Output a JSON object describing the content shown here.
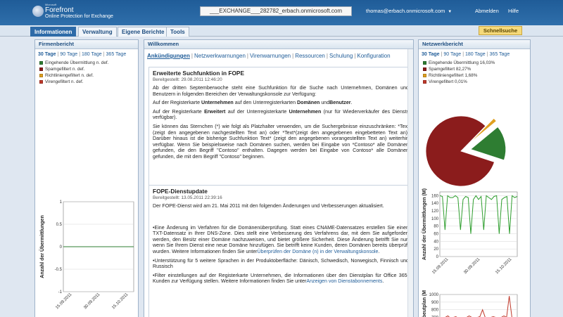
{
  "header": {
    "logo_small": "Microsoft",
    "logo_product": "Forefront",
    "logo_sub": "Online Protection for Exchange",
    "tenant": "___EXCHANGE___282782_erbach.onmicrosoft.com",
    "user": "thomas@erbach.onmicrosoft.com",
    "links": [
      "Abmelden",
      "Hilfe"
    ]
  },
  "tabs": [
    "Informationen",
    "Verwaltung",
    "Eigene Berichte",
    "Tools"
  ],
  "quick_search": "Schnellsuche",
  "left_panel": {
    "title": "Firmenbericht",
    "ranges": [
      "30 Tage",
      "90 Tage",
      "180 Tage",
      "365 Tage"
    ],
    "legend": [
      {
        "label": "Eingehende Übermittlung n. def.",
        "color": "#2e7d32"
      },
      {
        "label": "Spamgefiltert n. def.",
        "color": "#8b1c1c"
      },
      {
        "label": "Richtliniengefiltert n. def.",
        "color": "#e0a020"
      },
      {
        "label": "Virengefiltert n. def.",
        "color": "#c0392b"
      }
    ]
  },
  "center_panel": {
    "title": "Willkommen",
    "subnav": [
      "Ankündigungen",
      "Netzwerkwarnungen",
      "Virenwarnungen",
      "Ressourcen",
      "Schulung",
      "Konfiguration"
    ],
    "news": [
      {
        "title": "Erweiterte Suchfunktion in FOPE",
        "date": "Bereitgestellt: 29.08.2011 12:46:20",
        "p1": "Ab der dritten Septemberwoche steht eine Suchfunktion für die Suche nach Unternehmen, Domänen und Benutzern in folgenden Bereichen der Verwaltungskonsole zur Verfügung:",
        "p2a": "Auf der Registerkarte ",
        "p2b": "Unternehmen",
        "p2c": " auf den Unterregisterkarten ",
        "p2d": "Domänen",
        "p2e": " und",
        "p2f": "Benutzer",
        "p2g": ".",
        "p3a": "Auf der Registerkarte ",
        "p3b": "Erweitert",
        "p3c": " auf der Unterregisterkarte ",
        "p3d": "Unternehmen",
        "p3e": " (nur für Wiederverkäufer des Diensts verfügbar).",
        "p4": "Sie können das Sternchen (*) wie folgt als Platzhalter verwenden, um die Suchergebnisse einzuschränken: *Text (zeigt den angegebenen nachgestellten Text an) oder *Text*(zeigt den angegebenen eingebetteten Text an). Darüber hinaus ist die bisherige Suchfunktion Text* (zeigt den angegebenen vorangestellten Text an) weiterhin verfügbar. Wenn Sie beispielsweise nach Domänen suchen, werden bei Eingabe von *Contoso* alle Domänen gefunden, die den Begriff \"Contoso\" enthalten. Dagegen werden bei Eingabe von Contoso* alle Domänen gefunden, die mit dem Begriff \"Contoso\" beginnen."
      },
      {
        "title": "FOPE-Dienstupdate",
        "date": "Bereitgestellt: 13.05.2011 22:39:16",
        "p1": "Der FOPE-Dienst wird am 21. Mai 2011 mit den folgenden Änderungen und Verbesserungen aktualisiert.",
        "p2": "•Eine Änderung im Verfahren für die Domänenüberprüfung. Statt eines CNAME-Datensatzes erstellen Sie einen TXT-Datensatz in Ihrer DNS-Zone. Dies stellt eine Verbesserung des Verfahrens dar, mit dem Sie aufgefordert werden, den Besitz einer Domäne nachzuweisen, und bietet größere Sicherheit. Diese Änderung betrifft Sie nur, wenn Sie Ihrem Dienst eine neue Domäne hinzufügen. Sie betrifft keine Kunden, deren Domänen bereits überprüft wurden. Weitere Informationen finden Sie unter",
        "p2link": "Überprüfen der Domäne (n) in der Verwaltungskonsole",
        "p2end": ".",
        "p3": "•Unterstützung für 5 weitere Sprachen in der Produktoberfläche: Dänisch, Schwedisch, Norwegisch, Finnisch und Russisch",
        "p4": "•Filter einstellungen auf der Registerkarte Unternehmen, die Informationen über den Dienstplan für Office 365-Kunden zur Verfügung stellen. Weitere Informationen finden Sie unter",
        "p4link": "Anzeigen von Dienstabonnements",
        "p4end": "."
      }
    ]
  },
  "right_panel": {
    "title": "Netzwerkbericht",
    "ranges": [
      "30 Tage",
      "90 Tage",
      "180 Tage",
      "365 Tage"
    ],
    "legend": [
      {
        "label": "Eingehende Übermittlung 16,03%",
        "color": "#2e7d32"
      },
      {
        "label": "Spamgefiltert 82,27%",
        "color": "#8b1c1c"
      },
      {
        "label": "Richtliniengefiltert 1,68%",
        "color": "#e0a020"
      },
      {
        "label": "Virengefiltert 0,01%",
        "color": "#c0392b"
      }
    ]
  },
  "chart_data": [
    {
      "type": "line",
      "ylabel": "Anzahl der Übermittlungen",
      "x_ticks": [
        "15.09.2011",
        "30.09.2011",
        "15.10.2011"
      ],
      "y_ticks": [
        1,
        0.5,
        0,
        -0.5,
        -1
      ],
      "ylim": [
        -1,
        1
      ],
      "series": [
        {
          "color": "#2e7d32",
          "values": [
            0,
            0,
            0,
            0,
            0,
            0,
            0,
            0,
            0,
            0,
            0,
            0,
            0,
            0,
            0,
            0,
            0,
            0,
            0,
            0,
            0,
            0,
            0,
            0,
            0,
            0,
            0,
            0,
            0,
            0
          ]
        }
      ]
    },
    {
      "type": "pie",
      "slices": [
        {
          "label": "Eingehende Übermittlung",
          "value": 16.03,
          "color": "#2e7d32"
        },
        {
          "label": "Spamgefiltert",
          "value": 82.27,
          "color": "#8b1c1c"
        },
        {
          "label": "Richtliniengefiltert",
          "value": 1.68,
          "color": "#e0a020"
        },
        {
          "label": "Virengefiltert",
          "value": 0.01,
          "color": "#c0392b"
        }
      ]
    },
    {
      "type": "line",
      "ylabel": "Anzahl der Übermittlungen (M)",
      "x_ticks": [
        "15.09.2011",
        "30.09.2011",
        "15.10.2011"
      ],
      "y_ticks": [
        160,
        140,
        120,
        100,
        80,
        60,
        40,
        20,
        0
      ],
      "ylim": [
        0,
        170
      ],
      "series": [
        {
          "color": "#2e9e2e",
          "values": [
            160,
            158,
            70,
            160,
            155,
            155,
            160,
            155,
            70,
            150,
            158,
            155,
            60,
            150,
            160,
            150,
            158,
            70,
            160,
            155,
            150,
            158,
            160,
            60,
            150,
            155,
            158,
            60,
            160,
            155,
            158
          ]
        }
      ]
    },
    {
      "type": "line",
      "ylabel": "Ausbeutplan (M)",
      "y_ticks": [
        1000,
        900,
        800,
        700
      ],
      "ylim": [
        650,
        1000
      ],
      "series": [
        {
          "color": "#c0392b",
          "values": [
            700,
            680,
            700,
            720,
            690,
            700,
            710,
            690,
            700,
            680,
            700,
            720,
            700,
            690,
            700,
            710,
            800,
            700,
            690,
            700,
            710,
            700,
            690,
            700,
            720,
            700,
            980,
            700,
            690,
            700
          ]
        }
      ]
    }
  ]
}
